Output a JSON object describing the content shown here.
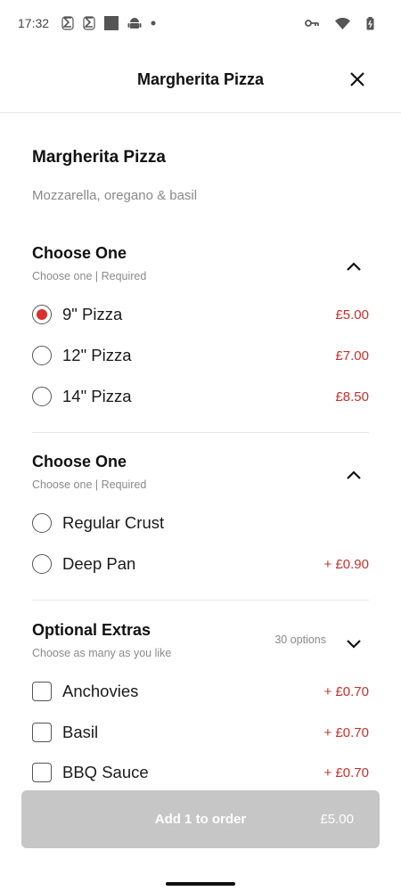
{
  "status_bar": {
    "time": "17:32",
    "left_icons": [
      "s-notification-icon",
      "s-notification-icon",
      "square-icon",
      "android-icon",
      "dot-icon"
    ],
    "right_icons": [
      "vpn-key-icon",
      "wifi-icon",
      "battery-icon"
    ]
  },
  "header": {
    "title": "Margherita Pizza",
    "close_icon": "close-icon"
  },
  "item": {
    "title": "Margherita Pizza",
    "description": "Mozzarella, oregano & basil"
  },
  "sections": [
    {
      "title": "Choose One",
      "subtitle": "Choose one  |  Required",
      "expanded": true,
      "options": [
        {
          "label": "9\" Pizza",
          "price": "£5.00",
          "selected": true
        },
        {
          "label": "12\" Pizza",
          "price": "£7.00",
          "selected": false
        },
        {
          "label": "14\" Pizza",
          "price": "£8.50",
          "selected": false
        }
      ]
    },
    {
      "title": "Choose One",
      "subtitle": "Choose one  |  Required",
      "expanded": true,
      "options": [
        {
          "label": "Regular Crust",
          "price": "",
          "selected": false
        },
        {
          "label": "Deep Pan",
          "price": "+ £0.90",
          "selected": false
        }
      ]
    },
    {
      "title": "Optional Extras",
      "subtitle": "Choose as many as you like",
      "options_count": "30 options",
      "expanded": false,
      "options": [
        {
          "label": "Anchovies",
          "price": "+ £0.70",
          "checked": false
        },
        {
          "label": "Basil",
          "price": "+ £0.70",
          "checked": false
        },
        {
          "label": "BBQ Sauce",
          "price": "+ £0.70",
          "checked": false
        }
      ]
    }
  ],
  "order_bar": {
    "label": "Add 1 to order",
    "total": "£5.00"
  },
  "colors": {
    "accent": "#d8302f",
    "price": "#c9302c",
    "button_disabled": "#c6c6c6"
  }
}
